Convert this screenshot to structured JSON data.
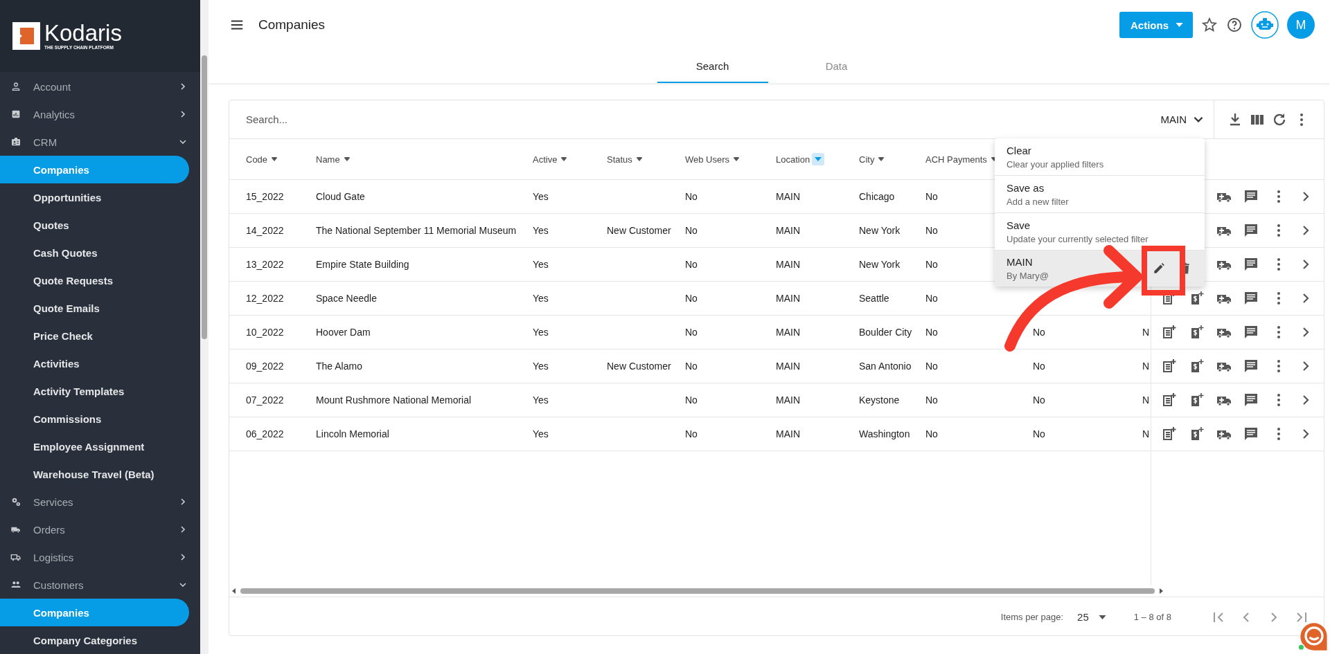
{
  "sidebar": {
    "logo": {
      "name": "Kodaris",
      "tagline": "THE SUPPLY CHAIN PLATFORM"
    },
    "items": [
      {
        "label": "Account",
        "expanded": false
      },
      {
        "label": "Analytics",
        "expanded": false
      },
      {
        "label": "CRM",
        "expanded": true,
        "children": [
          {
            "label": "Companies",
            "selected": true
          },
          {
            "label": "Opportunities",
            "selected": false
          },
          {
            "label": "Quotes",
            "selected": false
          },
          {
            "label": "Cash Quotes",
            "selected": false
          },
          {
            "label": "Quote Requests",
            "selected": false
          },
          {
            "label": "Quote Emails",
            "selected": false
          },
          {
            "label": "Price Check",
            "selected": false
          },
          {
            "label": "Activities",
            "selected": false
          },
          {
            "label": "Activity Templates",
            "selected": false
          },
          {
            "label": "Commissions",
            "selected": false
          },
          {
            "label": "Employee Assignment",
            "selected": false
          },
          {
            "label": "Warehouse Travel (Beta)",
            "selected": false
          }
        ]
      },
      {
        "label": "Services",
        "expanded": false
      },
      {
        "label": "Orders",
        "expanded": false
      },
      {
        "label": "Logistics",
        "expanded": false
      },
      {
        "label": "Customers",
        "expanded": true,
        "children": [
          {
            "label": "Companies",
            "selected": true
          },
          {
            "label": "Company Categories",
            "selected": false
          }
        ]
      }
    ]
  },
  "header": {
    "title": "Companies",
    "actions_button": "Actions",
    "avatar": "M"
  },
  "tabs": [
    {
      "label": "Search",
      "selected": true
    },
    {
      "label": "Data",
      "selected": false
    }
  ],
  "search": {
    "placeholder": "Search...",
    "filter": "MAIN"
  },
  "table": {
    "columns": [
      {
        "label": "Code",
        "filtered": false
      },
      {
        "label": "Name",
        "filtered": false
      },
      {
        "label": "Active",
        "filtered": false
      },
      {
        "label": "Status",
        "filtered": false
      },
      {
        "label": "Web Users",
        "filtered": false
      },
      {
        "label": "Location",
        "filtered": true
      },
      {
        "label": "City",
        "filtered": false
      },
      {
        "label": "ACH Payments",
        "filtered": false
      },
      {},
      {}
    ],
    "rows": [
      {
        "cells": [
          "15_2022",
          "Cloud Gate",
          "Yes",
          null,
          "No",
          "MAIN",
          "Chicago",
          "No",
          null,
          null
        ]
      },
      {
        "cells": [
          "14_2022",
          "The National September 11 Memorial Museum",
          "Yes",
          "New Customer",
          "No",
          "MAIN",
          "New York",
          "No",
          null,
          null
        ]
      },
      {
        "cells": [
          "13_2022",
          "Empire State Building",
          "Yes",
          null,
          "No",
          "MAIN",
          "New York",
          "No",
          null,
          null
        ]
      },
      {
        "cells": [
          "12_2022",
          "Space Needle",
          "Yes",
          null,
          "No",
          "MAIN",
          "Seattle",
          "No",
          null,
          null
        ]
      },
      {
        "cells": [
          "10_2022",
          "Hoover Dam",
          "Yes",
          null,
          "No",
          "MAIN",
          "Boulder City",
          "No",
          "No",
          "N"
        ]
      },
      {
        "cells": [
          "09_2022",
          "The Alamo",
          "Yes",
          "New Customer",
          "No",
          "MAIN",
          "San Antonio",
          "No",
          "No",
          "N"
        ]
      },
      {
        "cells": [
          "07_2022",
          "Mount Rushmore National Memorial",
          "Yes",
          null,
          "No",
          "MAIN",
          "Keystone",
          "No",
          "No",
          "N"
        ]
      },
      {
        "cells": [
          "06_2022",
          "Lincoln Memorial",
          "Yes",
          null,
          "No",
          "MAIN",
          "Washington",
          "No",
          "No",
          "N"
        ]
      }
    ]
  },
  "filter_menu": {
    "items": [
      {
        "title": "Clear",
        "subtitle": "Clear your applied filters",
        "selected": false
      },
      {
        "title": "Save as",
        "subtitle": "Add a new filter",
        "selected": false
      },
      {
        "title": "Save",
        "subtitle": "Update your currently selected filter",
        "selected": false
      },
      {
        "title": "MAIN",
        "subtitle": "By Mary@",
        "selected": true,
        "kind": "saved"
      }
    ]
  },
  "paginator": {
    "label": "Items per page:",
    "page_size": "25",
    "range": "1 – 8 of 8"
  },
  "annotations": {
    "highlight_box": true,
    "arrow": true
  }
}
